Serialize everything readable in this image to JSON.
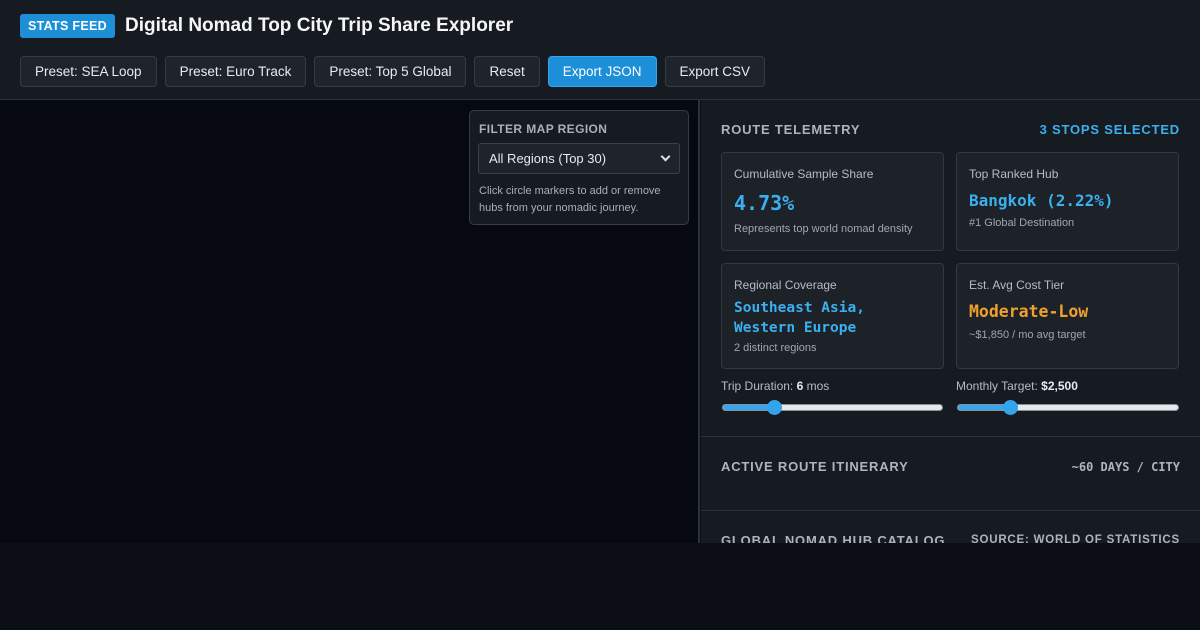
{
  "header": {
    "badge": "STATS FEED",
    "title": "Digital Nomad Top City Trip Share Explorer"
  },
  "toolbar": {
    "buttons": [
      "Preset: SEA Loop",
      "Preset: Euro Track",
      "Preset: Top 5 Global",
      "Reset",
      "Export JSON",
      "Export CSV"
    ]
  },
  "filter": {
    "title": "Filter Map Region",
    "selected": "All Regions (Top 30)",
    "hint": "Click circle markers to add or remove hubs from your nomadic journey."
  },
  "telemetry": {
    "title": "Route Telemetry",
    "selection_count": "3 Stops Selected",
    "cards": {
      "share": {
        "label": "Cumulative Sample Share",
        "value": "4.73%",
        "sub": "Represents top world nomad density"
      },
      "hub": {
        "label": "Top Ranked Hub",
        "value": "Bangkok (2.22%)",
        "sub": "#1 Global Destination"
      },
      "coverage": {
        "label": "Regional Coverage",
        "value": "Southeast Asia, Western Europe",
        "sub": "2 distinct regions"
      },
      "cost": {
        "label": "Est. Avg Cost Tier",
        "value": "Moderate-Low",
        "sub": "~$1,850 / mo avg target"
      }
    },
    "duration": {
      "label": "Trip Duration:",
      "value": "6",
      "unit": "mos",
      "fraction": 0.235
    },
    "budget": {
      "label": "Monthly Target:",
      "value": "$2,500",
      "fraction": 0.235
    }
  },
  "itinerary": {
    "title": "Active Route Itinerary",
    "note": "~60 days / city"
  },
  "catalog": {
    "title": "Global Nomad Hub Catalog",
    "source": "Source: World of Statistics"
  },
  "colors": {
    "accent": "#3ab0ee",
    "cost": "#f0a030",
    "primary_button": "#1c8fd8"
  }
}
